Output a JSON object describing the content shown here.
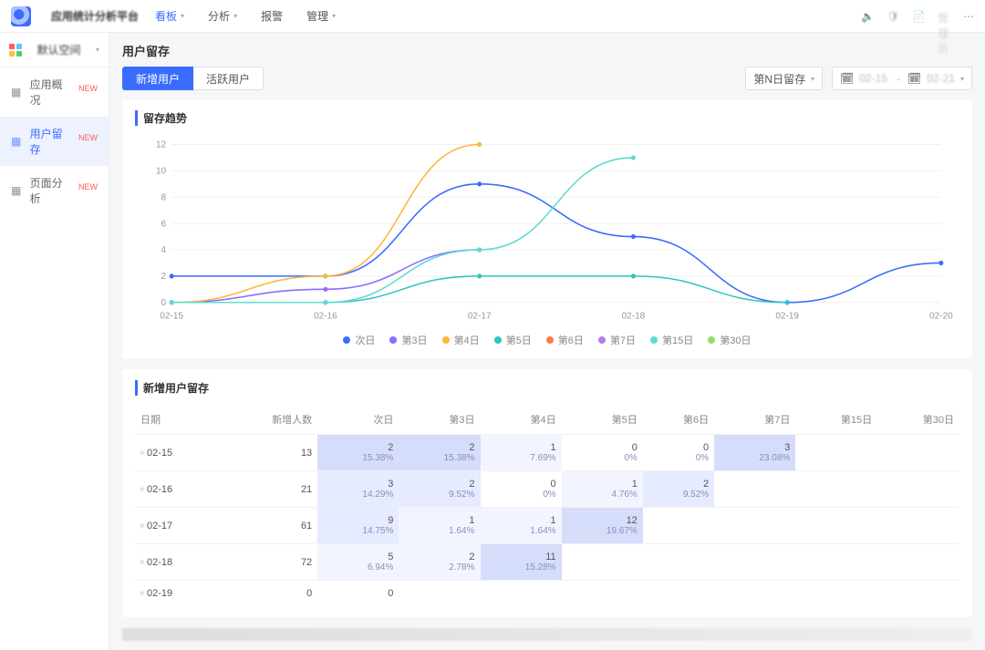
{
  "header": {
    "brand": "应用统计分析平台",
    "nav": [
      "看板",
      "分析",
      "报警",
      "管理"
    ],
    "nav_active": 0,
    "user": "管理员"
  },
  "sidebar": {
    "workspace": "默认空间",
    "items": [
      {
        "icon": "grid",
        "label": "应用概况",
        "new": true
      },
      {
        "icon": "user",
        "label": "用户留存",
        "new": true,
        "active": true
      },
      {
        "icon": "page",
        "label": "页面分析",
        "new": true
      }
    ]
  },
  "page": {
    "title": "用户留存",
    "tabs": {
      "new_user": "新增用户",
      "active_user": "活跃用户"
    },
    "selector": "第N日留存",
    "date_from_label": "02-15",
    "date_to_label": "02-21"
  },
  "chart_card": {
    "title": "留存趋势"
  },
  "chart_data": {
    "type": "line",
    "x": [
      "02-15",
      "02-16",
      "02-17",
      "02-18",
      "02-19",
      "02-20"
    ],
    "xlabel": "",
    "ylabel": "",
    "ylim": [
      0,
      12
    ],
    "series": [
      {
        "name": "次日",
        "color": "#3b6cff",
        "values": [
          2,
          2,
          9,
          5,
          0,
          3
        ]
      },
      {
        "name": "第3日",
        "color": "#8d6cff",
        "values": [
          0,
          1,
          4,
          null,
          null,
          null
        ]
      },
      {
        "name": "第4日",
        "color": "#ffb43b",
        "values": [
          0,
          2,
          12,
          null,
          null,
          null
        ]
      },
      {
        "name": "第5日",
        "color": "#2ec4c4",
        "values": [
          0,
          0,
          2,
          2,
          0,
          null
        ]
      },
      {
        "name": "第6日",
        "color": "#ff7a45",
        "values": [
          0,
          0,
          null,
          null,
          null,
          null
        ]
      },
      {
        "name": "第7日",
        "color": "#b37feb",
        "values": [
          0,
          null,
          null,
          null,
          null,
          null
        ]
      },
      {
        "name": "第15日",
        "color": "#5cdbd3",
        "values": [
          0,
          0,
          4,
          11,
          null,
          null
        ]
      },
      {
        "name": "第30日",
        "color": "#95de64",
        "values": [
          null,
          null,
          null,
          null,
          null,
          null
        ]
      }
    ]
  },
  "table_card": {
    "title": "新增用户留存"
  },
  "table": {
    "columns": [
      "日期",
      "新增人数",
      "次日",
      "第3日",
      "第4日",
      "第5日",
      "第6日",
      "第7日",
      "第15日",
      "第30日"
    ],
    "rows": [
      {
        "date": "02-15",
        "count": 13,
        "cells": [
          {
            "v": 2,
            "p": "15.38%"
          },
          {
            "v": 2,
            "p": "15.38%"
          },
          {
            "v": 1,
            "p": "7.69%"
          },
          {
            "v": 0,
            "p": "0%"
          },
          {
            "v": 0,
            "p": "0%"
          },
          {
            "v": 3,
            "p": "23.08%"
          },
          null,
          null
        ]
      },
      {
        "date": "02-16",
        "count": 21,
        "cells": [
          {
            "v": 3,
            "p": "14.29%"
          },
          {
            "v": 2,
            "p": "9.52%"
          },
          {
            "v": 0,
            "p": "0%"
          },
          {
            "v": 1,
            "p": "4.76%"
          },
          {
            "v": 2,
            "p": "9.52%"
          },
          null,
          null,
          null
        ]
      },
      {
        "date": "02-17",
        "count": 61,
        "cells": [
          {
            "v": 9,
            "p": "14.75%"
          },
          {
            "v": 1,
            "p": "1.64%"
          },
          {
            "v": 1,
            "p": "1.64%"
          },
          {
            "v": 12,
            "p": "19.67%"
          },
          null,
          null,
          null,
          null
        ]
      },
      {
        "date": "02-18",
        "count": 72,
        "cells": [
          {
            "v": 5,
            "p": "6.94%"
          },
          {
            "v": 2,
            "p": "2.78%"
          },
          {
            "v": 11,
            "p": "15.28%"
          },
          null,
          null,
          null,
          null,
          null
        ]
      },
      {
        "date": "02-19",
        "count": 0,
        "cells": [
          {
            "v": 0,
            "p": ""
          },
          null,
          null,
          null,
          null,
          null,
          null,
          null
        ]
      }
    ]
  }
}
